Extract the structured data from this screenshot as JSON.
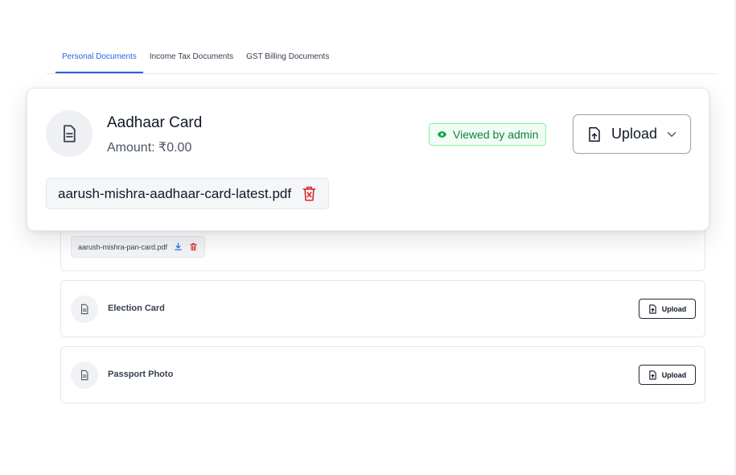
{
  "tabs": [
    {
      "label": "Personal  Documents",
      "active": true
    },
    {
      "label": "Income Tax  Documents",
      "active": false
    },
    {
      "label": "GST Billing  Documents",
      "active": false
    }
  ],
  "popover": {
    "title": "Aadhaar Card",
    "amount": "Amount: ₹0.00",
    "status_badge": "Viewed by admin",
    "upload_label": "Upload",
    "file_name": "aarush-mishra-aadhaar-card-latest.pdf"
  },
  "cards": {
    "pan": {
      "file_name": "aarush-mishra-pan-card.pdf"
    },
    "election": {
      "title": "Election Card",
      "upload_label": "Upload"
    },
    "passport": {
      "title": "Passport Photo",
      "upload_label": "Upload"
    }
  },
  "colors": {
    "accent": "#2563eb",
    "status_green": "#15803d",
    "delete_red": "#dc2626",
    "download_blue": "#2563eb"
  },
  "icons": {
    "document": "document-icon",
    "upload": "file-upload-icon",
    "chevron": "chevron-down-icon",
    "eye": "eye-icon",
    "delete": "trash-icon",
    "download": "download-icon"
  }
}
